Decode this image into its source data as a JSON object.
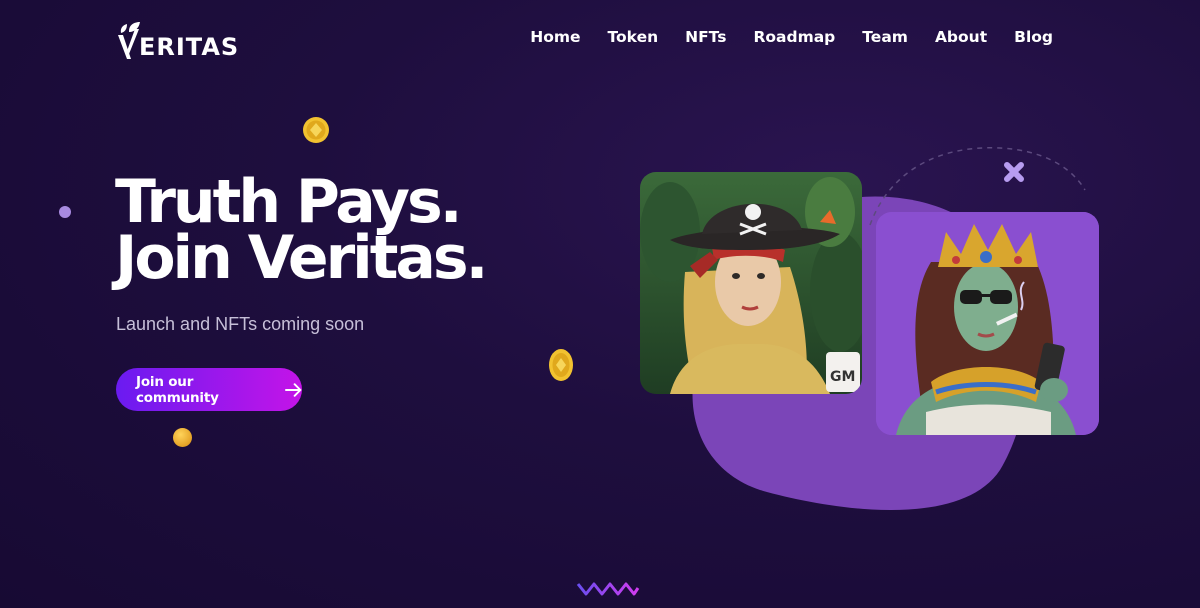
{
  "brand": {
    "name": "ERITAS",
    "logo_icon": "veritas-leaf-v-logo"
  },
  "nav": {
    "items": [
      {
        "label": "Home"
      },
      {
        "label": "Token"
      },
      {
        "label": "NFTs"
      },
      {
        "label": "Roadmap"
      },
      {
        "label": "Team"
      },
      {
        "label": "About"
      },
      {
        "label": "Blog"
      }
    ]
  },
  "hero": {
    "title_line1": "Truth Pays.",
    "title_line2": "Join Veritas.",
    "subtitle": "Launch and NFTs coming soon",
    "cta_label": "Join our community",
    "cta_icon": "arrow-right-icon"
  },
  "nft_cards": [
    {
      "name": "pirate-nft",
      "mug_text": "GM"
    },
    {
      "name": "queen-nft"
    }
  ],
  "colors": {
    "bg": "#1e0e3e",
    "cta_start": "#6a1bf0",
    "cta_end": "#c414e8",
    "blob": "#7b45b8",
    "card2_bg": "#8a4fd0",
    "coin": "#f2c230"
  }
}
